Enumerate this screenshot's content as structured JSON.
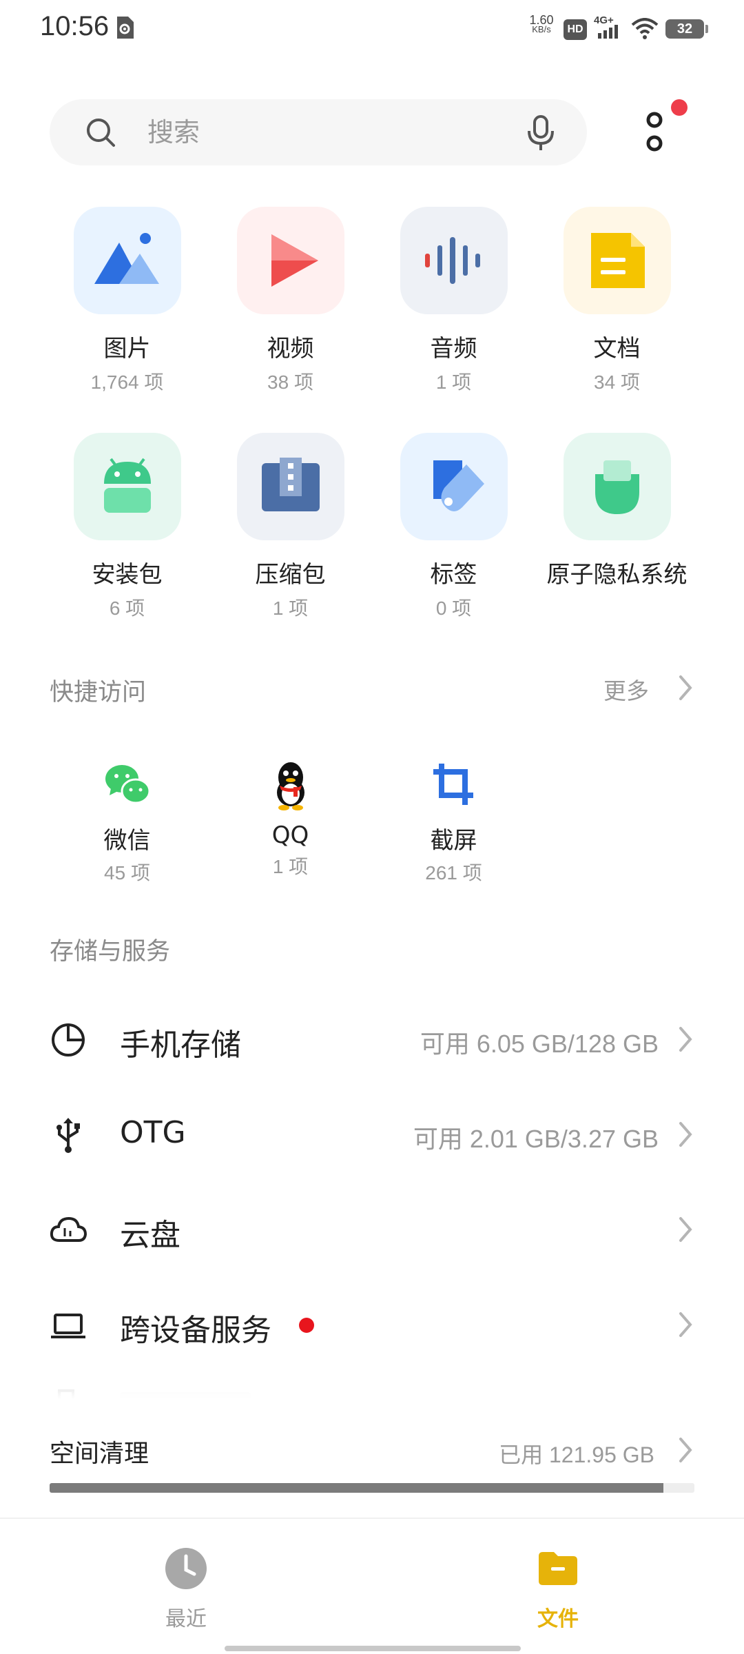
{
  "status_bar": {
    "time": "10:56",
    "net_speed_value": "1.60",
    "net_speed_unit": "KB/s",
    "hd": "HD",
    "network": "4G+",
    "battery": "32"
  },
  "search": {
    "placeholder": "搜索"
  },
  "categories": [
    {
      "label": "图片",
      "count": "1,764 项",
      "icon": "image-icon",
      "color": "#e8f3ff"
    },
    {
      "label": "视频",
      "count": "38 项",
      "icon": "video-icon",
      "color": "#fff0f0"
    },
    {
      "label": "音频",
      "count": "1 项",
      "icon": "audio-icon",
      "color": "#eef1f6"
    },
    {
      "label": "文档",
      "count": "34 项",
      "icon": "document-icon",
      "color": "#fff7e6"
    },
    {
      "label": "安装包",
      "count": "6 项",
      "icon": "android-icon",
      "color": "#e6f7f0"
    },
    {
      "label": "压缩包",
      "count": "1 项",
      "icon": "archive-icon",
      "color": "#eef1f6"
    },
    {
      "label": "标签",
      "count": "0 项",
      "icon": "tag-icon",
      "color": "#e8f3ff"
    },
    {
      "label": "原子隐私系统",
      "count": "",
      "icon": "privacy-icon",
      "color": "#e6f7f0"
    }
  ],
  "quick_access": {
    "title": "快捷访问",
    "more_label": "更多",
    "items": [
      {
        "label": "微信",
        "count": "45 项",
        "icon": "wechat-icon"
      },
      {
        "label": "QQ",
        "count": "1 项",
        "icon": "qq-icon"
      },
      {
        "label": "截屏",
        "count": "261 项",
        "icon": "crop-icon"
      }
    ]
  },
  "storage": {
    "title": "存储与服务",
    "rows": [
      {
        "label": "手机存储",
        "value": "可用 6.05 GB/128 GB",
        "icon": "pie-chart-icon"
      },
      {
        "label": "OTG",
        "value": "可用 2.01 GB/3.27 GB",
        "icon": "usb-icon"
      },
      {
        "label": "云盘",
        "value": "",
        "icon": "cloud-icon"
      },
      {
        "label": "跨设备服务",
        "value": "",
        "icon": "laptop-icon",
        "badge": true
      }
    ]
  },
  "cleanup": {
    "title": "空间清理",
    "used": "已用 121.95 GB",
    "used_fraction": 0.952
  },
  "bottom_nav": {
    "recent": "最近",
    "files": "文件",
    "active_color": "#e6b30a",
    "inactive_color": "#9a9a9a"
  }
}
